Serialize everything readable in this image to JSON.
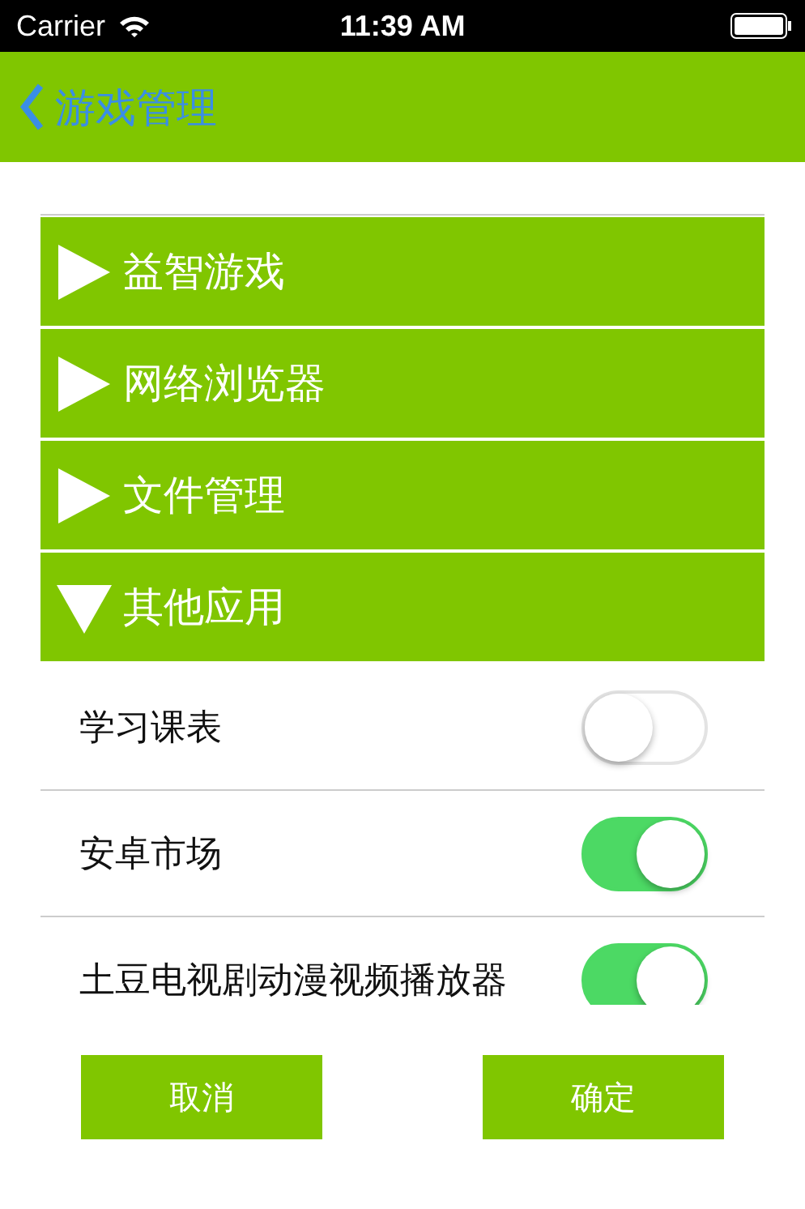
{
  "status_bar": {
    "carrier": "Carrier",
    "time": "11:39 AM"
  },
  "nav_bar": {
    "back_label": "游戏管理"
  },
  "groups": [
    {
      "label": "益智游戏",
      "expanded": false
    },
    {
      "label": "网络浏览器",
      "expanded": false
    },
    {
      "label": "文件管理",
      "expanded": false
    },
    {
      "label": "其他应用",
      "expanded": true,
      "children": [
        {
          "label": "学习课表",
          "on": false
        },
        {
          "label": "安卓市场",
          "on": true
        },
        {
          "label": "土豆电视剧动漫视频播放器",
          "on": true
        }
      ]
    }
  ],
  "buttons": [
    "取消",
    "确定"
  ]
}
